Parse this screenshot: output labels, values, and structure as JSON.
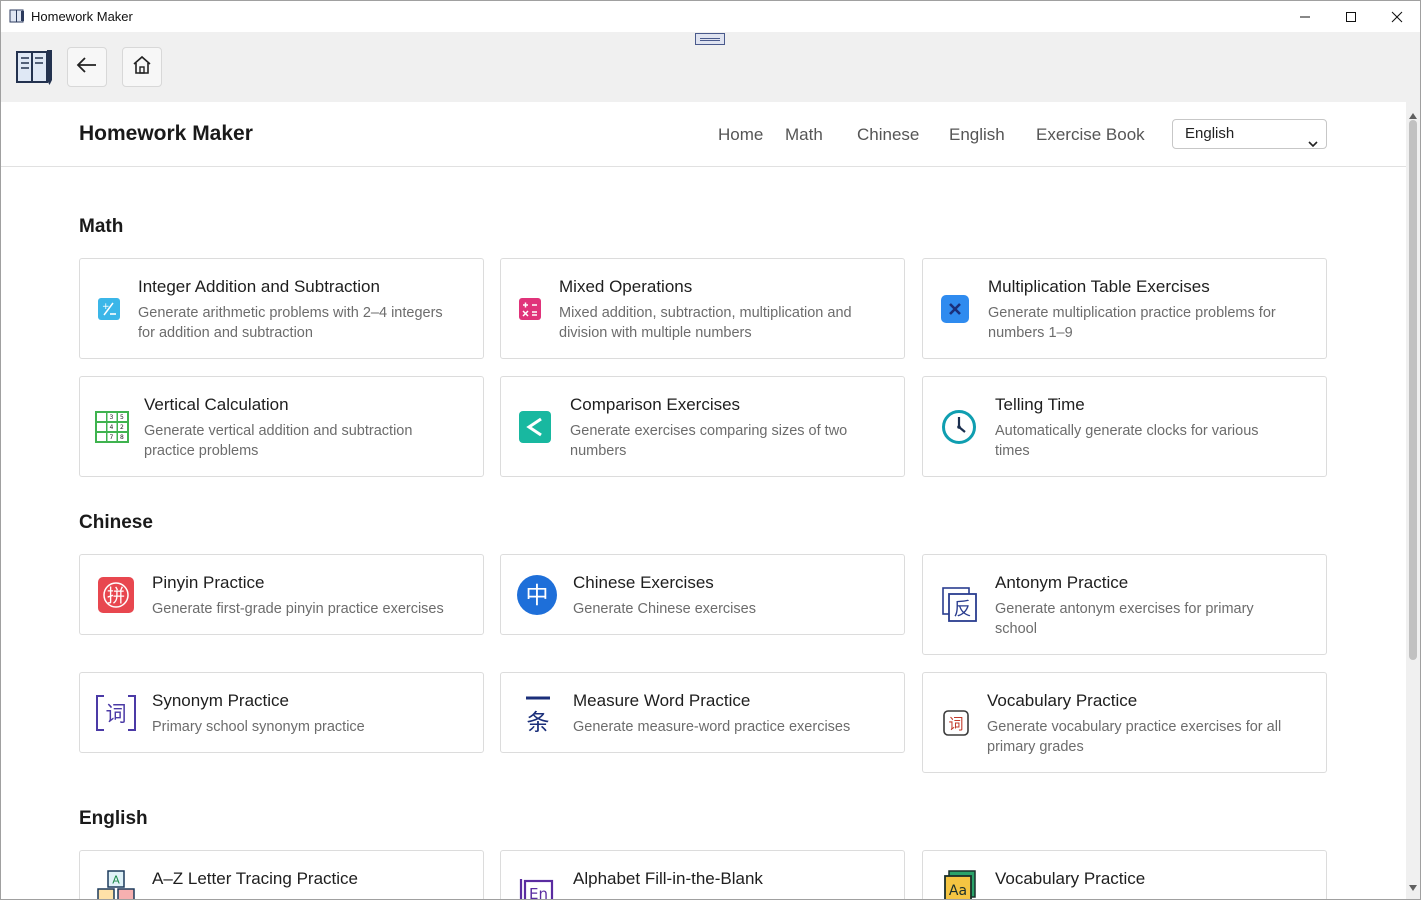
{
  "window": {
    "title": "Homework Maker",
    "controls": [
      "minimize-icon",
      "maximize-icon",
      "close-icon"
    ]
  },
  "toolbar": {
    "buttons": [
      "back-arrow-icon",
      "home-icon"
    ]
  },
  "navbar": {
    "brand": "Homework Maker",
    "links": [
      "Home",
      "Math",
      "Chinese",
      "English",
      "Exercise Book"
    ],
    "language_select": {
      "value": "English"
    }
  },
  "sections": [
    {
      "title": "Math",
      "cards": [
        {
          "title": "Integer Addition and Subtraction",
          "desc_1": "Generate arithmetic problems with 2–4 integers",
          "desc_2": "for addition and subtraction",
          "icon": "plus-minus-icon"
        },
        {
          "title": "Mixed Operations",
          "desc_1": "Mixed addition, subtraction, multiplication and",
          "desc_2": "division with multiple numbers",
          "icon": "calculator-icon"
        },
        {
          "title": "Multiplication Table Exercises",
          "desc_1": "Generate multiplication practice problems for",
          "desc_2": "numbers 1–9",
          "icon": "multiply-icon"
        },
        {
          "title": "Vertical Calculation",
          "desc_1": "Generate vertical addition and subtraction",
          "desc_2": "practice problems",
          "icon": "grid-numbers-icon"
        },
        {
          "title": "Comparison Exercises",
          "desc_1": "Generate exercises comparing sizes of two",
          "desc_2": "numbers",
          "icon": "less-than-icon"
        },
        {
          "title": "Telling Time",
          "desc_1": "Automatically generate clocks for various",
          "desc_2": "times",
          "icon": "clock-icon"
        }
      ]
    },
    {
      "title": "Chinese",
      "cards": [
        {
          "title": "Pinyin Practice",
          "desc_1": "Generate first-grade pinyin practice exercises",
          "desc_2": "",
          "icon": "pinyin-icon",
          "glyph": "拼"
        },
        {
          "title": "Chinese Exercises",
          "desc_1": "Generate Chinese exercises",
          "desc_2": "",
          "icon": "chinese-char-icon",
          "glyph": "中"
        },
        {
          "title": "Antonym Practice",
          "desc_1": "Generate antonym exercises for primary",
          "desc_2": "school",
          "icon": "antonym-icon",
          "glyph": "反"
        },
        {
          "title": "Synonym Practice",
          "desc_1": "Primary school synonym practice",
          "desc_2": "",
          "icon": "synonym-icon",
          "glyph": "词"
        },
        {
          "title": "Measure Word Practice",
          "desc_1": "Generate measure-word practice exercises",
          "desc_2": "",
          "icon": "measure-word-icon",
          "glyph": "一条"
        },
        {
          "title": "Vocabulary Practice",
          "desc_1": "Generate vocabulary practice exercises for all",
          "desc_2": "primary grades",
          "icon": "vocabulary-icon",
          "glyph": "词"
        }
      ]
    },
    {
      "title": "English",
      "cards": [
        {
          "title": "A–Z Letter Tracing Practice",
          "desc_1": "",
          "desc_2": "",
          "icon": "letter-blocks-icon",
          "glyph": "A"
        },
        {
          "title": "Alphabet Fill-in-the-Blank",
          "desc_1": "",
          "desc_2": "",
          "icon": "en-book-icon",
          "glyph": "En"
        },
        {
          "title": "Vocabulary Practice",
          "desc_1": "",
          "desc_2": "",
          "icon": "dictionary-icon",
          "glyph": "Aa"
        }
      ]
    }
  ],
  "colors": {
    "accent_blue": "#1e6fd9",
    "math_cyan": "#3bb6e8",
    "math_pink": "#e0337a",
    "math_green": "#18b8a0",
    "pinyin_red": "#e8474f"
  }
}
